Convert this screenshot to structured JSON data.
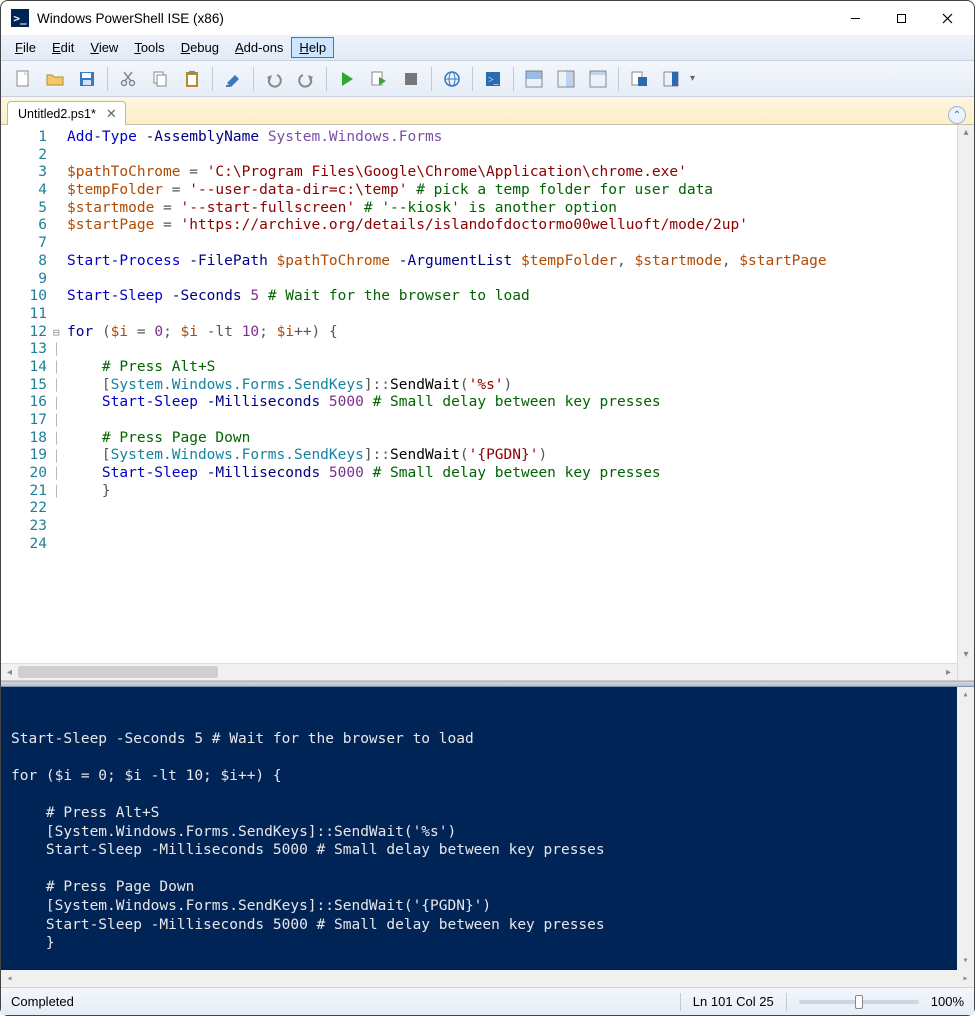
{
  "window": {
    "title": "Windows PowerShell ISE (x86)"
  },
  "menu": {
    "file": "File",
    "edit": "Edit",
    "view": "View",
    "tools": "Tools",
    "debug": "Debug",
    "addons": "Add-ons",
    "help": "Help"
  },
  "tab": {
    "title": "Untitled2.ps1*"
  },
  "code": {
    "lines": [
      {
        "n": 1,
        "html": "<span class='c-cmd'>Add-Type</span> <span class='c-param'>-AssemblyName</span> <span class='c-type2'>System.Windows.Forms</span>"
      },
      {
        "n": 2,
        "html": ""
      },
      {
        "n": 3,
        "html": "<span class='c-var'>$pathToChrome</span> <span class='c-op'>=</span> <span class='c-str'>'C:\\Program Files\\Google\\Chrome\\Application\\chrome.exe'</span>"
      },
      {
        "n": 4,
        "html": "<span class='c-var'>$tempFolder</span> <span class='c-op'>=</span> <span class='c-str'>'--user-data-dir=c:\\temp'</span> <span class='c-cmt'># pick a temp folder for user data</span>"
      },
      {
        "n": 5,
        "html": "<span class='c-var'>$startmode</span> <span class='c-op'>=</span> <span class='c-str'>'--start-fullscreen'</span> <span class='c-cmt'># '--kiosk' is another option</span>"
      },
      {
        "n": 6,
        "html": "<span class='c-var'>$startPage</span> <span class='c-op'>=</span> <span class='c-str'>'https://archive.org/details/islandofdoctormo00welluoft/mode/2up'</span>"
      },
      {
        "n": 7,
        "html": ""
      },
      {
        "n": 8,
        "html": "<span class='c-cmd'>Start-Process</span> <span class='c-param'>-FilePath</span> <span class='c-var'>$pathToChrome</span> <span class='c-param'>-ArgumentList</span> <span class='c-var'>$tempFolder</span><span class='c-op'>,</span> <span class='c-var'>$startmode</span><span class='c-op'>,</span> <span class='c-var'>$startPage</span>"
      },
      {
        "n": 9,
        "html": ""
      },
      {
        "n": 10,
        "html": "<span class='c-cmd'>Start-Sleep</span> <span class='c-param'>-Seconds</span> <span class='c-num'>5</span> <span class='c-cmt'># Wait for the browser to load</span>"
      },
      {
        "n": 11,
        "html": ""
      },
      {
        "n": 12,
        "fold": "⊟",
        "html": "<span class='c-kw'>for</span> <span class='c-op'>(</span><span class='c-var'>$i</span> <span class='c-op'>=</span> <span class='c-num'>0</span><span class='c-op'>;</span> <span class='c-var'>$i</span> <span class='c-op'>-lt</span> <span class='c-num'>10</span><span class='c-op'>;</span> <span class='c-var'>$i</span><span class='c-op'>++) {</span>"
      },
      {
        "n": 13,
        "bar": true,
        "html": ""
      },
      {
        "n": 14,
        "bar": true,
        "html": "    <span class='c-cmt'># Press Alt+S</span>"
      },
      {
        "n": 15,
        "bar": true,
        "html": "    <span class='c-op'>[</span><span class='c-type'>System.Windows.Forms.SendKeys</span><span class='c-op'>]::</span><span class='c-meth'>SendWait</span><span class='c-op'>(</span><span class='c-str'>'%s'</span><span class='c-op'>)</span>"
      },
      {
        "n": 16,
        "bar": true,
        "html": "    <span class='c-cmd'>Start-Sleep</span> <span class='c-param'>-Milliseconds</span> <span class='c-num'>5000</span> <span class='c-cmt'># Small delay between key presses</span>"
      },
      {
        "n": 17,
        "bar": true,
        "html": ""
      },
      {
        "n": 18,
        "bar": true,
        "html": "    <span class='c-cmt'># Press Page Down</span>"
      },
      {
        "n": 19,
        "bar": true,
        "html": "    <span class='c-op'>[</span><span class='c-type'>System.Windows.Forms.SendKeys</span><span class='c-op'>]::</span><span class='c-meth'>SendWait</span><span class='c-op'>(</span><span class='c-str'>'{PGDN}'</span><span class='c-op'>)</span>"
      },
      {
        "n": 20,
        "bar": true,
        "html": "    <span class='c-cmd'>Start-Sleep</span> <span class='c-param'>-Milliseconds</span> <span class='c-num'>5000</span> <span class='c-cmt'># Small delay between key presses</span>"
      },
      {
        "n": 21,
        "bar": true,
        "html": "    <span class='c-op'>}</span>"
      },
      {
        "n": 22,
        "html": ""
      },
      {
        "n": 23,
        "html": ""
      },
      {
        "n": 24,
        "html": ""
      }
    ]
  },
  "console": {
    "text": "Start-Sleep -Seconds 5 # Wait for the browser to load\n\nfor ($i = 0; $i -lt 10; $i++) {\n\n    # Press Alt+S\n    [System.Windows.Forms.SendKeys]::SendWait('%s')\n    Start-Sleep -Milliseconds 5000 # Small delay between key presses\n\n    # Press Page Down\n    [System.Windows.Forms.SendKeys]::SendWait('{PGDN}')\n    Start-Sleep -Milliseconds 5000 # Small delay between key presses\n    }"
  },
  "status": {
    "msg": "Completed",
    "pos": "Ln 101  Col 25",
    "zoom": "100%"
  }
}
